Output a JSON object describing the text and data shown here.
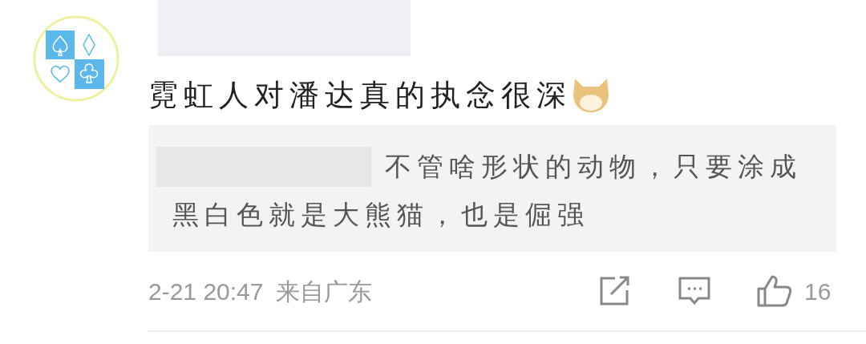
{
  "comment": {
    "text": "霓虹人对潘达真的执念很深"
  },
  "reply": {
    "lines": [
      "不管啥形状的动物，只要涂成",
      "黑白色就是大熊猫，也是倔强"
    ]
  },
  "footer": {
    "time": "2-21 20:47",
    "source": "来自广东",
    "likes": "16"
  }
}
